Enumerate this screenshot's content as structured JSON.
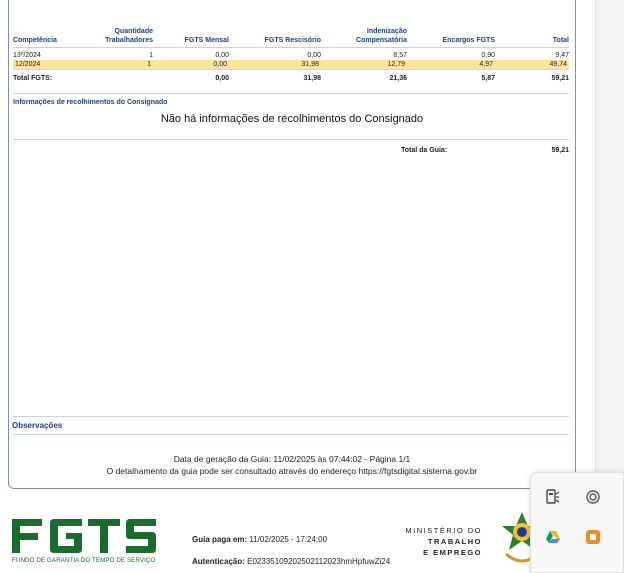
{
  "table": {
    "headers": [
      "Competência",
      "Quantidade Trabalhadores",
      "FGTS Mensal",
      "FGTS Rescisório",
      "Indenização Compensatória",
      "Encargos FGTS",
      "Total"
    ],
    "rows": [
      [
        "13º/2024",
        "1",
        "0,00",
        "0,00",
        "8,57",
        "0,90",
        "9,47"
      ],
      [
        "12/2024",
        "1",
        "0,00",
        "31,98",
        "12,79",
        "4,97",
        "49,74"
      ]
    ],
    "total_row": [
      "Total FGTS:",
      "",
      "0,00",
      "31,98",
      "21,36",
      "5,87",
      "59,21"
    ]
  },
  "consignado": {
    "title": "Informações de recolhimentos do Consignado",
    "message": "Não há informações de recolhimentos do Consignado"
  },
  "guia_total": {
    "label": "Total da Guia:",
    "value": "59,21"
  },
  "observacoes": {
    "title": "Observações"
  },
  "footer": {
    "line1": "Data de geração da Guia: 11/02/2025 às 07:44:02 - Página 1/1",
    "line2": "O detalhamento da guia pode ser consultado através do endereço https://fgtsdigital.sisterna.gov.br"
  },
  "bottom": {
    "logo_text": "FGTS",
    "logo_subtitle": "FUNDO DE GARANTIA DO TEMPO DE SERVIÇO",
    "paid_label": "Guia paga em:",
    "paid_value": "11/02/2025 - 17:24:00",
    "auth_label": "Autenticação:",
    "auth_value": "E02335109202502112023hmHpfuwZi24",
    "ministry_1": "MINISTÉRIO DO",
    "ministry_2": "TRABALHO",
    "ministry_3": "E EMPREGO"
  },
  "tray": {
    "icons": [
      "device-icon",
      "wifi-icon",
      "google-drive-icon",
      "orange-app-icon"
    ]
  },
  "colors": {
    "header_blue": "#1d3f8a",
    "highlight": "#fbe3a0",
    "fgts_green": "#1a6b2e",
    "doc_border": "#7a8fb8"
  }
}
